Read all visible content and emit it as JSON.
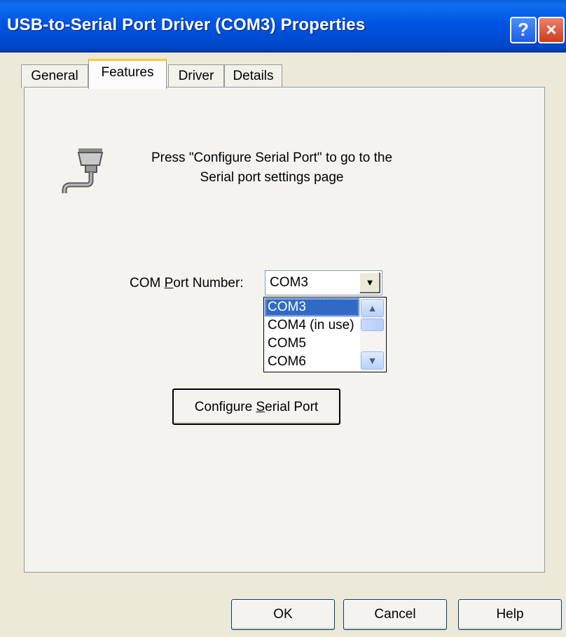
{
  "window": {
    "title": "USB-to-Serial Port Driver (COM3) Properties",
    "help_glyph": "?",
    "close_glyph": "×"
  },
  "tabs": [
    {
      "label": "General",
      "active": false
    },
    {
      "label": "Features",
      "active": true
    },
    {
      "label": "Driver",
      "active": false
    },
    {
      "label": "Details",
      "active": false
    }
  ],
  "features": {
    "icon": "serial-port-icon",
    "info_line1": "Press \"Configure Serial Port\" to go to the",
    "info_line2": "Serial port settings page",
    "com_label_pre": "COM ",
    "com_label_mnemonic": "P",
    "com_label_post": "ort Number:",
    "com_selected": "COM3",
    "com_options": [
      "COM3",
      "COM4 (in use)",
      "COM5",
      "COM6"
    ],
    "configure_pre": "Configure ",
    "configure_mnemonic": "S",
    "configure_post": "erial Port"
  },
  "footer": {
    "ok": "OK",
    "cancel": "Cancel",
    "help": "Help"
  }
}
